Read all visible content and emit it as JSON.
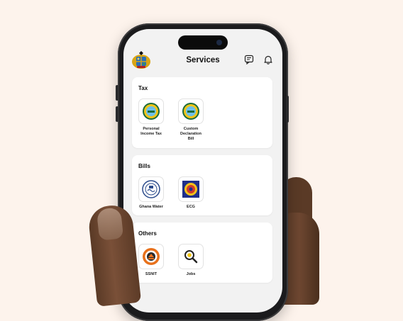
{
  "header": {
    "title": "Services"
  },
  "sections": [
    {
      "title": "Tax",
      "items": [
        {
          "label": "Personal Income Tax",
          "line1": "Personal",
          "line2": "Income Tax"
        },
        {
          "label": "Custom Declaration Bill",
          "line1": "Custom",
          "line2": "Declaration",
          "line3": "Bill"
        }
      ]
    },
    {
      "title": "Bills",
      "items": [
        {
          "label": "Ghana Water"
        },
        {
          "label": "ECG"
        }
      ]
    },
    {
      "title": "Others",
      "items": [
        {
          "label": "SSNIT"
        },
        {
          "label": "Jobs"
        }
      ]
    }
  ],
  "icons": {
    "crest": "ghana-coat-of-arms-icon",
    "chat": "message-icon",
    "notifications": "bell-icon"
  },
  "colors": {
    "background": "#fdf3ec",
    "screen": "#f2f2f2",
    "card": "#ffffff"
  }
}
